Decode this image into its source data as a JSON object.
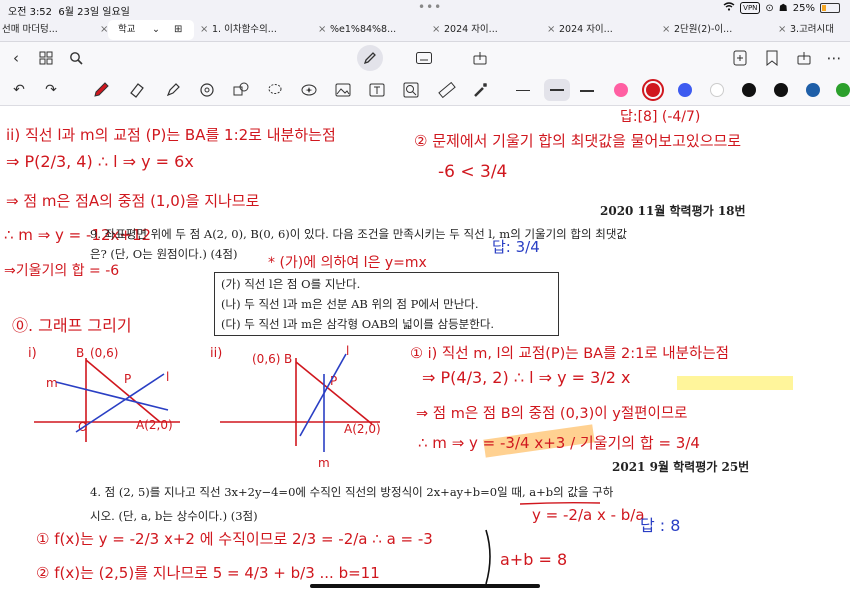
{
  "status_bar": {
    "time": "오전 3:52",
    "date": "6월 23일 일요일",
    "more_dots": "•••",
    "vpn": "VPN",
    "battery_text": "25%",
    "battery_level": 0.25
  },
  "tabs": [
    {
      "label": "선매 마더텅..."
    },
    {
      "label": "학교",
      "active": true
    },
    {
      "label": "1. 이차함수의..."
    },
    {
      "label": "%e1%84%8..."
    },
    {
      "label": "2024 자이..."
    },
    {
      "label": "2024 자이..."
    },
    {
      "label": "2단원(2)-이..."
    },
    {
      "label": "3.고려시대"
    }
  ],
  "colors": {
    "ink_red": "#d0171e",
    "ink_blue": "#2a3fc4",
    "highlight_yellow": "#fff27a",
    "highlight_orange": "#ffb347",
    "palette": [
      "#ff5fa2",
      "#d0171e",
      "#3d5bf0",
      "#ffffff",
      "#111111",
      "#111111",
      "#1f5fa8",
      "#2ca02c"
    ]
  },
  "icons": {
    "nav": [
      "back-icon",
      "grid-icon",
      "search-icon",
      "pen-mode-icon",
      "keyboard-icon",
      "share-icon",
      "new-page-icon",
      "bookmark-icon",
      "more-icon"
    ],
    "tools": [
      "undo-icon",
      "redo-icon",
      "pen-icon",
      "eraser-icon",
      "highlighter-icon",
      "shapes-icon",
      "lasso-icon",
      "stamp-icon",
      "image-icon",
      "camera-icon",
      "text-icon",
      "zoom-icon",
      "ruler-icon",
      "laser-icon"
    ]
  },
  "document": {
    "top_answer": "답:[8] (-4/7)",
    "note_ii_title": "ii) 직선 l과 m의 교점 (P)는 BA를 1:2로 내분하는점",
    "note_ii_p": "⇒ P(2/3, 4) ∴ l ⇒ y = 6x",
    "note_ii_m": "⇒ 점 m은 점A의 중점 (1,0)을 지나므로",
    "note_ii_meq": "∴ m ⇒ y = -12x+12",
    "note_ii_slope": "⇒기울기의 합 = -6",
    "note_2_title": "② 문제에서 기울기 합의 최댓값을 물어보고있으므로",
    "note_2_cmp": "-6 < 3/4",
    "source_1": "2020 11월 학력평가 18번",
    "problem_1_line1": "9. 좌표평면 위에 두 점 A(2, 0), B(0, 6)이 있다. 다음 조건을 만족시키는 두 직선 l, m의 기울기의 합의 최댓값",
    "problem_1_line2": "은? (단, O는 원점이다.) (4점)",
    "answer_1": "답: 3/4",
    "note_ga": "* (가)에 의하여 l은 y=mx",
    "conditions": [
      "(가) 직선 l은 점 O를 지난다.",
      "(나) 두 직선 l과 m은 선분 AB 위의 점 P에서 만난다.",
      "(다) 두 직선 l과 m은 삼각형 OAB의 넓이를 삼등분한다."
    ],
    "note_graph": "⓪. 그래프 그리기",
    "graph_i_label": "i)",
    "graph_ii_label": "ii)",
    "graph_labels": {
      "B": "B",
      "B_coord": "(0,6)",
      "A_coord": "A(2,0)",
      "O": "O",
      "P": "P",
      "m": "m",
      "l": "l"
    },
    "note_1_title": "① i) 직선 m, l의 교점(P)는 BA를 2:1로 내분하는점",
    "note_1_p": "⇒ P(4/3, 2) ∴ l ⇒ y = 3/2 x",
    "note_1_m": "⇒ 점 m은 점 B의 중점 (0,3)이 y절편이므로",
    "note_1_meq": "∴ m ⇒ y = -3/4 x+3 / 기울기의 합 = 3/4",
    "source_2": "2021 9월 학력평가 25번",
    "problem_2_line1": "4. 점 (2, 5)를 지나고 직선 3x+2y−4=0에 수직인 직선의 방정식이 2x+ay+b=0일 때, a+b의 값을 구하",
    "problem_2_line2": "시오. (단, a, b는 상수이다.) (3점)",
    "note_p2_form": "y = -2/a x - b/a",
    "answer_2": "답 : 8",
    "note_p2_1": "① f(x)는 y = -2/3 x+2 에 수직이므로 2/3 = -2/a ∴ a = -3",
    "note_p2_2": "② f(x)는 (2,5)를 지나므로 5 = 4/3 + b/3 ... b=11",
    "note_p2_sum": "a+b = 8"
  }
}
